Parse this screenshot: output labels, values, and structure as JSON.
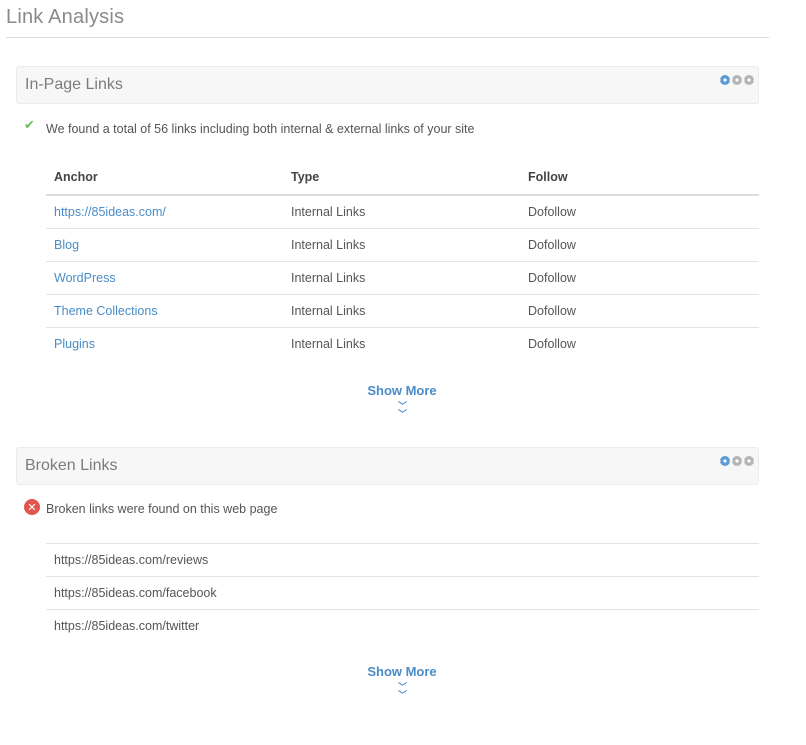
{
  "page": {
    "title": "Link Analysis"
  },
  "in_page_links": {
    "title": "In-Page Links",
    "status_message": "We found a total of 56 links including both internal & external links of your site",
    "columns": [
      "Anchor",
      "Type",
      "Follow"
    ],
    "rows": [
      {
        "anchor": "https://85ideas.com/",
        "type": "Internal Links",
        "follow": "Dofollow"
      },
      {
        "anchor": "Blog",
        "type": "Internal Links",
        "follow": "Dofollow"
      },
      {
        "anchor": "WordPress",
        "type": "Internal Links",
        "follow": "Dofollow"
      },
      {
        "anchor": "Theme Collections",
        "type": "Internal Links",
        "follow": "Dofollow"
      },
      {
        "anchor": "Plugins",
        "type": "Internal Links",
        "follow": "Dofollow"
      }
    ],
    "show_more_label": "Show More"
  },
  "broken_links": {
    "title": "Broken Links",
    "status_message": "Broken links were found on this web page",
    "items": [
      "https://85ideas.com/reviews",
      "https://85ideas.com/facebook",
      "https://85ideas.com/twitter"
    ],
    "show_more_label": "Show More"
  },
  "icons": {
    "success": "check-icon",
    "error": "x-circle-icon",
    "settings": "gear-icon",
    "expand": "double-chevron-down-icon"
  },
  "colors": {
    "accent": "#4a8cc7",
    "success": "#6bbf59",
    "error": "#e0564f"
  }
}
